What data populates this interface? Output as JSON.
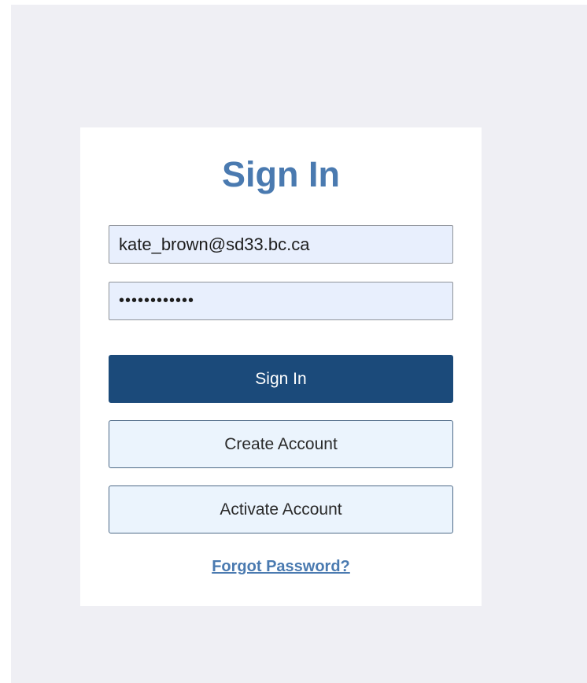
{
  "login": {
    "title": "Sign In",
    "email_value": "kate_brown@sd33.bc.ca",
    "password_value": "••••••••••••",
    "sign_in_label": "Sign In",
    "create_account_label": "Create Account",
    "activate_account_label": "Activate Account",
    "forgot_password_label": "Forgot Password?"
  },
  "colors": {
    "title": "#4a7ab0",
    "primary_button": "#1b4a7a",
    "secondary_button": "#ebf4fd",
    "field_background": "#e8effd",
    "page_background": "#efeff4"
  }
}
